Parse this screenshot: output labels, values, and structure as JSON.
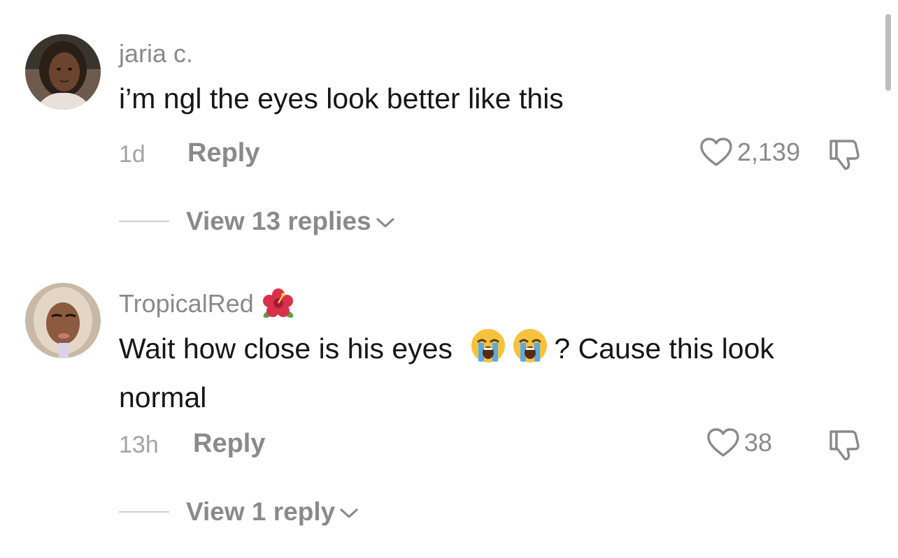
{
  "comments": [
    {
      "username": "jaria c.",
      "username_badge": "",
      "text_parts": [
        "i’m ngl the eyes look better like this"
      ],
      "timestamp": "1d",
      "reply_label": "Reply",
      "like_count": "2,139",
      "view_replies_label": "View 13 replies"
    },
    {
      "username": "TropicalRed",
      "username_badge": "hibiscus-emoji",
      "text_parts": [
        "Wait how close is his eyes",
        "? Cause this look normal"
      ],
      "inline_emojis": [
        "loudly-crying-face-emoji",
        "loudly-crying-face-emoji"
      ],
      "timestamp": "13h",
      "reply_label": "Reply",
      "like_count": "38",
      "view_replies_label": "View 1 reply"
    }
  ],
  "icons": {
    "like": "heart-outline-icon",
    "dislike": "thumbs-down-outline-icon",
    "expand": "chevron-down-icon"
  },
  "colors": {
    "text_primary": "#161616",
    "text_secondary": "#8a8a8a",
    "timestamp": "#a3a3a3"
  }
}
